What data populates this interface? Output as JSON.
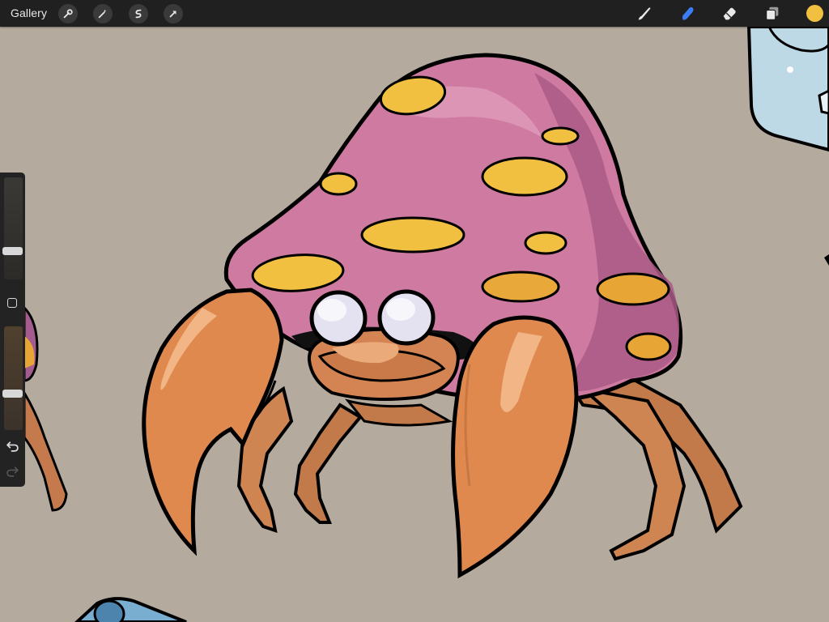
{
  "app": {
    "gallery_label": "Gallery"
  },
  "toolbar": {
    "left_tools": [
      "wrench-icon",
      "magic-wand-icon",
      "selection-icon",
      "transform-arrow-icon"
    ],
    "right_tools": [
      "brush-icon",
      "smudge-icon",
      "eraser-icon",
      "layers-icon"
    ],
    "active_tool": "smudge-icon",
    "current_color": "#f2c040"
  },
  "sidebar": {
    "brush_size_level": 0.28,
    "opacity_level": 0.35
  },
  "colors": {
    "canvas_background": "#b4aa9e",
    "shell": "#cf7aa0",
    "spots": "#f2c040",
    "body": "#e0894f",
    "eyes": "#e4e2f0",
    "active_tool": "#3b7df6"
  }
}
